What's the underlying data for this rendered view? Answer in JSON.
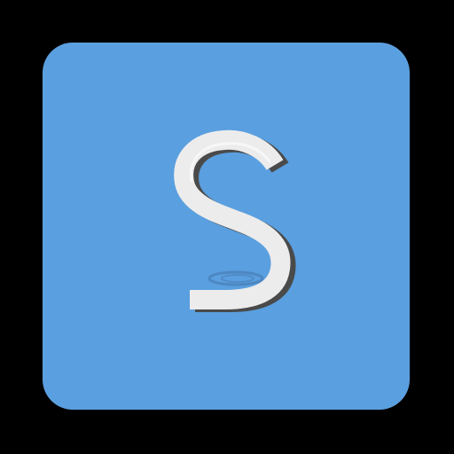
{
  "icon": {
    "letter": "S",
    "tile_color": "#5a9fdf",
    "background_color": "#000000",
    "glyph_color": "#ececec",
    "glyph_shadow_color": "#4a4a4a",
    "reflection_color": "#4a7fb8"
  }
}
